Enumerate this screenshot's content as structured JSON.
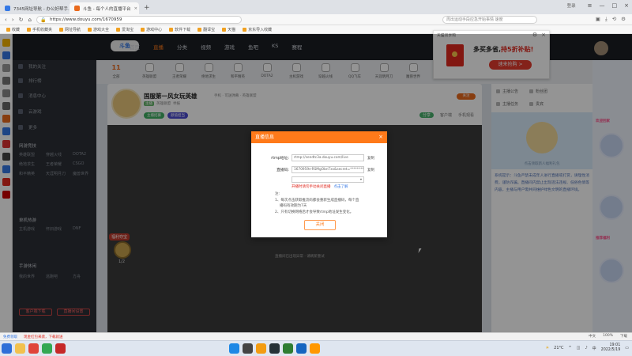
{
  "browser": {
    "tabs": [
      {
        "title": "7345网址导航 - 办公好帮手... ",
        "active": false
      },
      {
        "title": "斗鱼 - 每个人的直播平台",
        "active": true
      }
    ],
    "new_tab": "+",
    "login": "登录",
    "address": "https://www.douyu.com/1670959",
    "search_placeholder": "周出运动手段应急开始事情 速度",
    "bookmarks": [
      "收藏",
      "手机收藏夹",
      "网址导航",
      "游戏大全",
      "爱淘宝",
      "游戏中心",
      "软件下载",
      "翻译宝",
      "天猫",
      "京东导入收藏"
    ]
  },
  "site": {
    "logo": "斗鱼",
    "nav": [
      "首页",
      "直播",
      "分类",
      "视频",
      "游戏",
      "鱼吧",
      "KS",
      "赛程"
    ],
    "active_nav": "直播"
  },
  "sidebar": {
    "items": [
      "我的关注",
      "排行榜",
      "消息中心",
      "云游戏",
      "更多"
    ],
    "sections": [
      "网游竞技",
      "单机热游",
      "手游休闲"
    ],
    "games": [
      "英雄联盟",
      "穿越火线",
      "DOTA2",
      "绝地求生",
      "王者荣耀",
      "CSGO",
      "和平精英",
      "天涯明月刀",
      "魔兽世界",
      "主机游戏",
      "怀旧游戏",
      "DNF",
      "我的世界",
      "逃跑吧",
      "方舟"
    ],
    "buttons": [
      "客户端下载",
      "直播间设置"
    ]
  },
  "categories": [
    "全部",
    "英雄联盟",
    "王者荣耀",
    "绝地求生",
    "和平精英",
    "DOTA2",
    "主机游戏",
    "穿越火线",
    "QQ飞车",
    "天涯明月刀",
    "魔兽世界",
    "一起看",
    "户外直播",
    "更多"
  ],
  "room": {
    "title": "国服第一风女玩英雄",
    "tag": "手机 · 可送弹幕 · 英雄联盟",
    "badges": [
      "主播",
      "英雄联盟",
      "举报"
    ],
    "tags": [
      "主播招募",
      "颜值担当"
    ],
    "follow": "关注",
    "actions": [
      "分享",
      "客户端",
      "手机观看"
    ]
  },
  "lottery": {
    "label": "福利夺宝",
    "count": "1/2"
  },
  "player_hint": "直播间已出现异常 · 请刷新重试",
  "right_panel": {
    "tabs_row1": [
      "主播公告",
      "粉丝团"
    ],
    "tabs_row2": [
      "主播任务",
      "贵宾"
    ],
    "ad_caption": "点击领取新人福利礼包",
    "chat": "系统提示：斗鱼严禁未成年人进行直播或打赏，请理性消费，谨防诈骗。直播间内禁止出现违法违规、低俗色情等内容，主播与用户需共同维护绿色文明的直播环境。"
  },
  "decorations": [
    "欢迎回家",
    "推荐福利"
  ],
  "popup_ad": {
    "header": "天猫双享购",
    "message_prefix": "多买多省,",
    "message_highlight": "持5折补贴!",
    "cta": "速来抢购 >"
  },
  "modal": {
    "title": "直播信息",
    "rtmp_label": "rtmp地址:",
    "rtmp_value": "rtmp://sendtc3a.douyu.com/live",
    "key_label": "直播码:",
    "key_value": "1670959rrRSMgObnTxs&secret=**********",
    "copy_label": "复制",
    "select_value": "",
    "warning": "开播时请勿手动关闭直播",
    "warning_link": "点击了解",
    "notes": [
      "注:",
      "1、每次点击获取推流码都会重新生成直播码，每个直",
      "播码有效期为7天",
      "2、只有切换网络后才会导致rtmp地址发生变化。"
    ],
    "close_button": "关闭"
  },
  "statusbar": {
    "left": [
      "免费领取",
      "现金红包来袭，下载就送"
    ],
    "right": [
      "中文",
      "100%",
      "下载"
    ]
  },
  "taskbar": {
    "weather": "21°C",
    "ime": "中",
    "time": "19:01",
    "date": "2022/5/19"
  }
}
